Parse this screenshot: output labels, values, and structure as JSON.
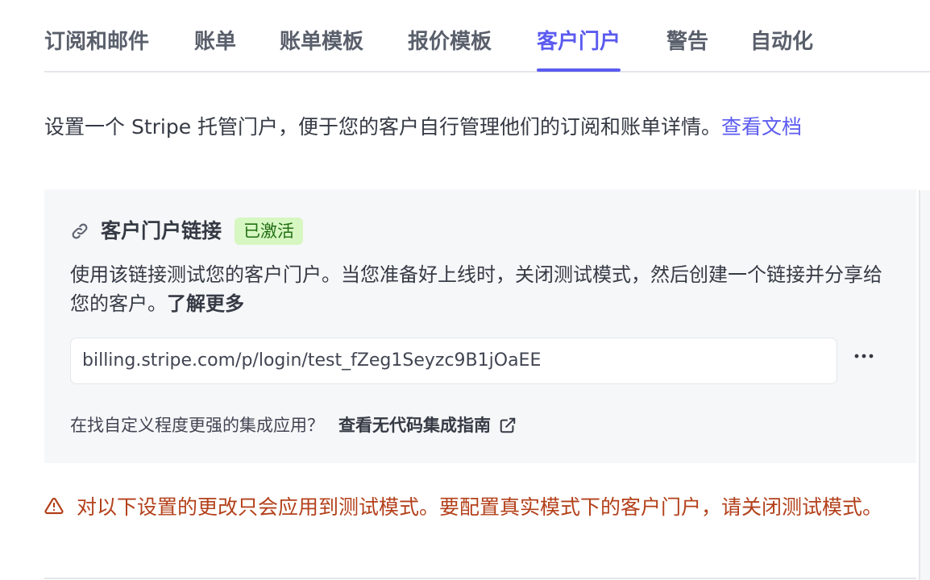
{
  "tabs": [
    {
      "label": "订阅和邮件"
    },
    {
      "label": "账单"
    },
    {
      "label": "账单模板"
    },
    {
      "label": "报价模板"
    },
    {
      "label": "客户门户",
      "active": true
    },
    {
      "label": "警告"
    },
    {
      "label": "自动化"
    }
  ],
  "description": {
    "text": "设置一个 Stripe 托管门户，便于您的客户自行管理他们的订阅和账单详情。",
    "link": "查看文档"
  },
  "portal_card": {
    "icon": "link-icon",
    "title": "客户门户链接",
    "badge": "已激活",
    "body": "使用该链接测试您的客户门户。当您准备好上线时，关闭测试模式，然后创建一个链接并分享给您的客户。",
    "learn_more": "了解更多",
    "url": "billing.stripe.com/p/login/test_fZeg1Seyzc9B1jOaEE",
    "more_icon": "more-horizontal-icon",
    "question": "在找自定义程度更强的集成应用？",
    "guide_link": "查看无代码集成指南",
    "guide_icon": "external-link-icon"
  },
  "warning": {
    "icon": "warning-triangle-icon",
    "text": "对以下设置的更改只会应用到测试模式。要配置真实模式下的客户门户，请关闭测试模式。"
  },
  "colors": {
    "accent": "#5b5bf0",
    "badge_bg": "#d7f7c2",
    "badge_text": "#216e13",
    "warning": "#b3401a",
    "card_bg": "#f6f7f9"
  }
}
